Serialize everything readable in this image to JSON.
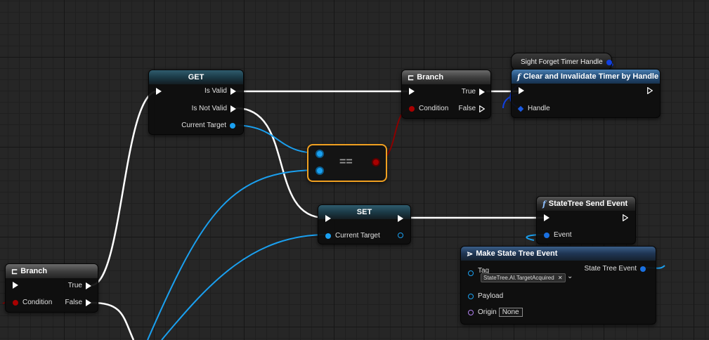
{
  "nodes": {
    "get": {
      "title": "GET",
      "pins": {
        "is_valid": "Is Valid",
        "is_not_valid": "Is Not Valid",
        "current_target": "Current Target"
      }
    },
    "branch_top": {
      "title": "Branch",
      "pins": {
        "true": "True",
        "false": "False",
        "condition": "Condition"
      }
    },
    "branch_left": {
      "title": "Branch",
      "pins": {
        "true": "True",
        "false": "False",
        "condition": "Condition"
      }
    },
    "equals": {
      "label": "=="
    },
    "set": {
      "title": "SET",
      "pins": {
        "current_target": "Current Target"
      }
    },
    "sight_var": {
      "label": "Sight Forget Timer Handle"
    },
    "clear_timer": {
      "title": "Clear and Invalidate Timer by Handle",
      "pins": {
        "handle": "Handle"
      }
    },
    "send_event": {
      "title": "StateTree Send Event",
      "pins": {
        "event": "Event"
      }
    },
    "make_event": {
      "title": "Make State Tree Event",
      "pins": {
        "tag": "Tag",
        "tag_value": "StateTree.AI.TargetAcquired",
        "payload": "Payload",
        "origin": "Origin",
        "origin_value": "None",
        "output": "State Tree Event"
      }
    }
  },
  "colors": {
    "exec_wire": "#ffffff",
    "object_wire": "#1aa0f0",
    "bool_wire": "#8a0000",
    "handle_wire": "#1040e0",
    "selected_outline": "#f0a020"
  },
  "icons": {
    "branch": "branch-icon",
    "function": "function-icon",
    "make_struct": "make-struct-icon"
  }
}
